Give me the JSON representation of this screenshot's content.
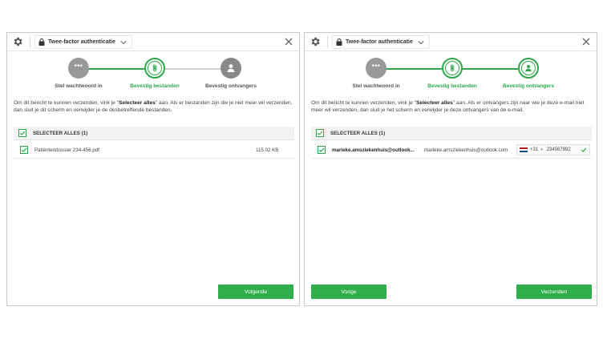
{
  "colors": {
    "accent": "#2ea84a",
    "button": "#2fae4b",
    "step_done": "#999999"
  },
  "left": {
    "header_title": "Twee-factor authenticatie",
    "steps": [
      "Stel wachtwoord in",
      "Bevestig bestanden",
      "Bevestig ontvangers"
    ],
    "step_done_glyph": "***",
    "instruction_pre": "Om dit bericht te kunnen verzenden, vink je \"",
    "instruction_bold": "Selecteer alles",
    "instruction_post": "\" aan. Als er bestanden zijn die je niet meer wil verzenden, dan sluit je dit scherm en verwijder je de desbetreffende bestanden.",
    "select_all_label": "SELECTEER ALLES (1)",
    "files": [
      {
        "name": "Patiëntendossier 234-456.pdf",
        "size": "115.02 KB"
      }
    ],
    "next_button": "Volgende"
  },
  "right": {
    "header_title": "Twee-factor authenticatie",
    "steps": [
      "Stel wachtwoord in",
      "Bevestig bestanden",
      "Bevestig ontvangers"
    ],
    "step_done_glyph": "***",
    "instruction_pre": "Om dit bericht te kunnen verzenden, vink je \"",
    "instruction_bold": "Selecteer alles",
    "instruction_post": "\" aan. Als er ontvangers zijn naar wie je deze e-mail niet meer wil verzenden, dan sluit je het scherm en verwijder je deze ontvangers van de e-mail.",
    "select_all_label": "SELECTEER ALLES (1)",
    "recipients": [
      {
        "name": "marieke.amsziekenhuis@outlook...",
        "email": "marieke.amsziekenhuis@outlook.com",
        "country_code": "+31",
        "phone": "234567892"
      }
    ],
    "back_button": "Vorige",
    "send_button": "Verzenden"
  },
  "icons": {
    "settings": "gear-icon",
    "lock": "lock-icon",
    "close": "close-icon",
    "attachment": "paperclip-icon",
    "user": "user-icon",
    "check": "check-icon"
  }
}
